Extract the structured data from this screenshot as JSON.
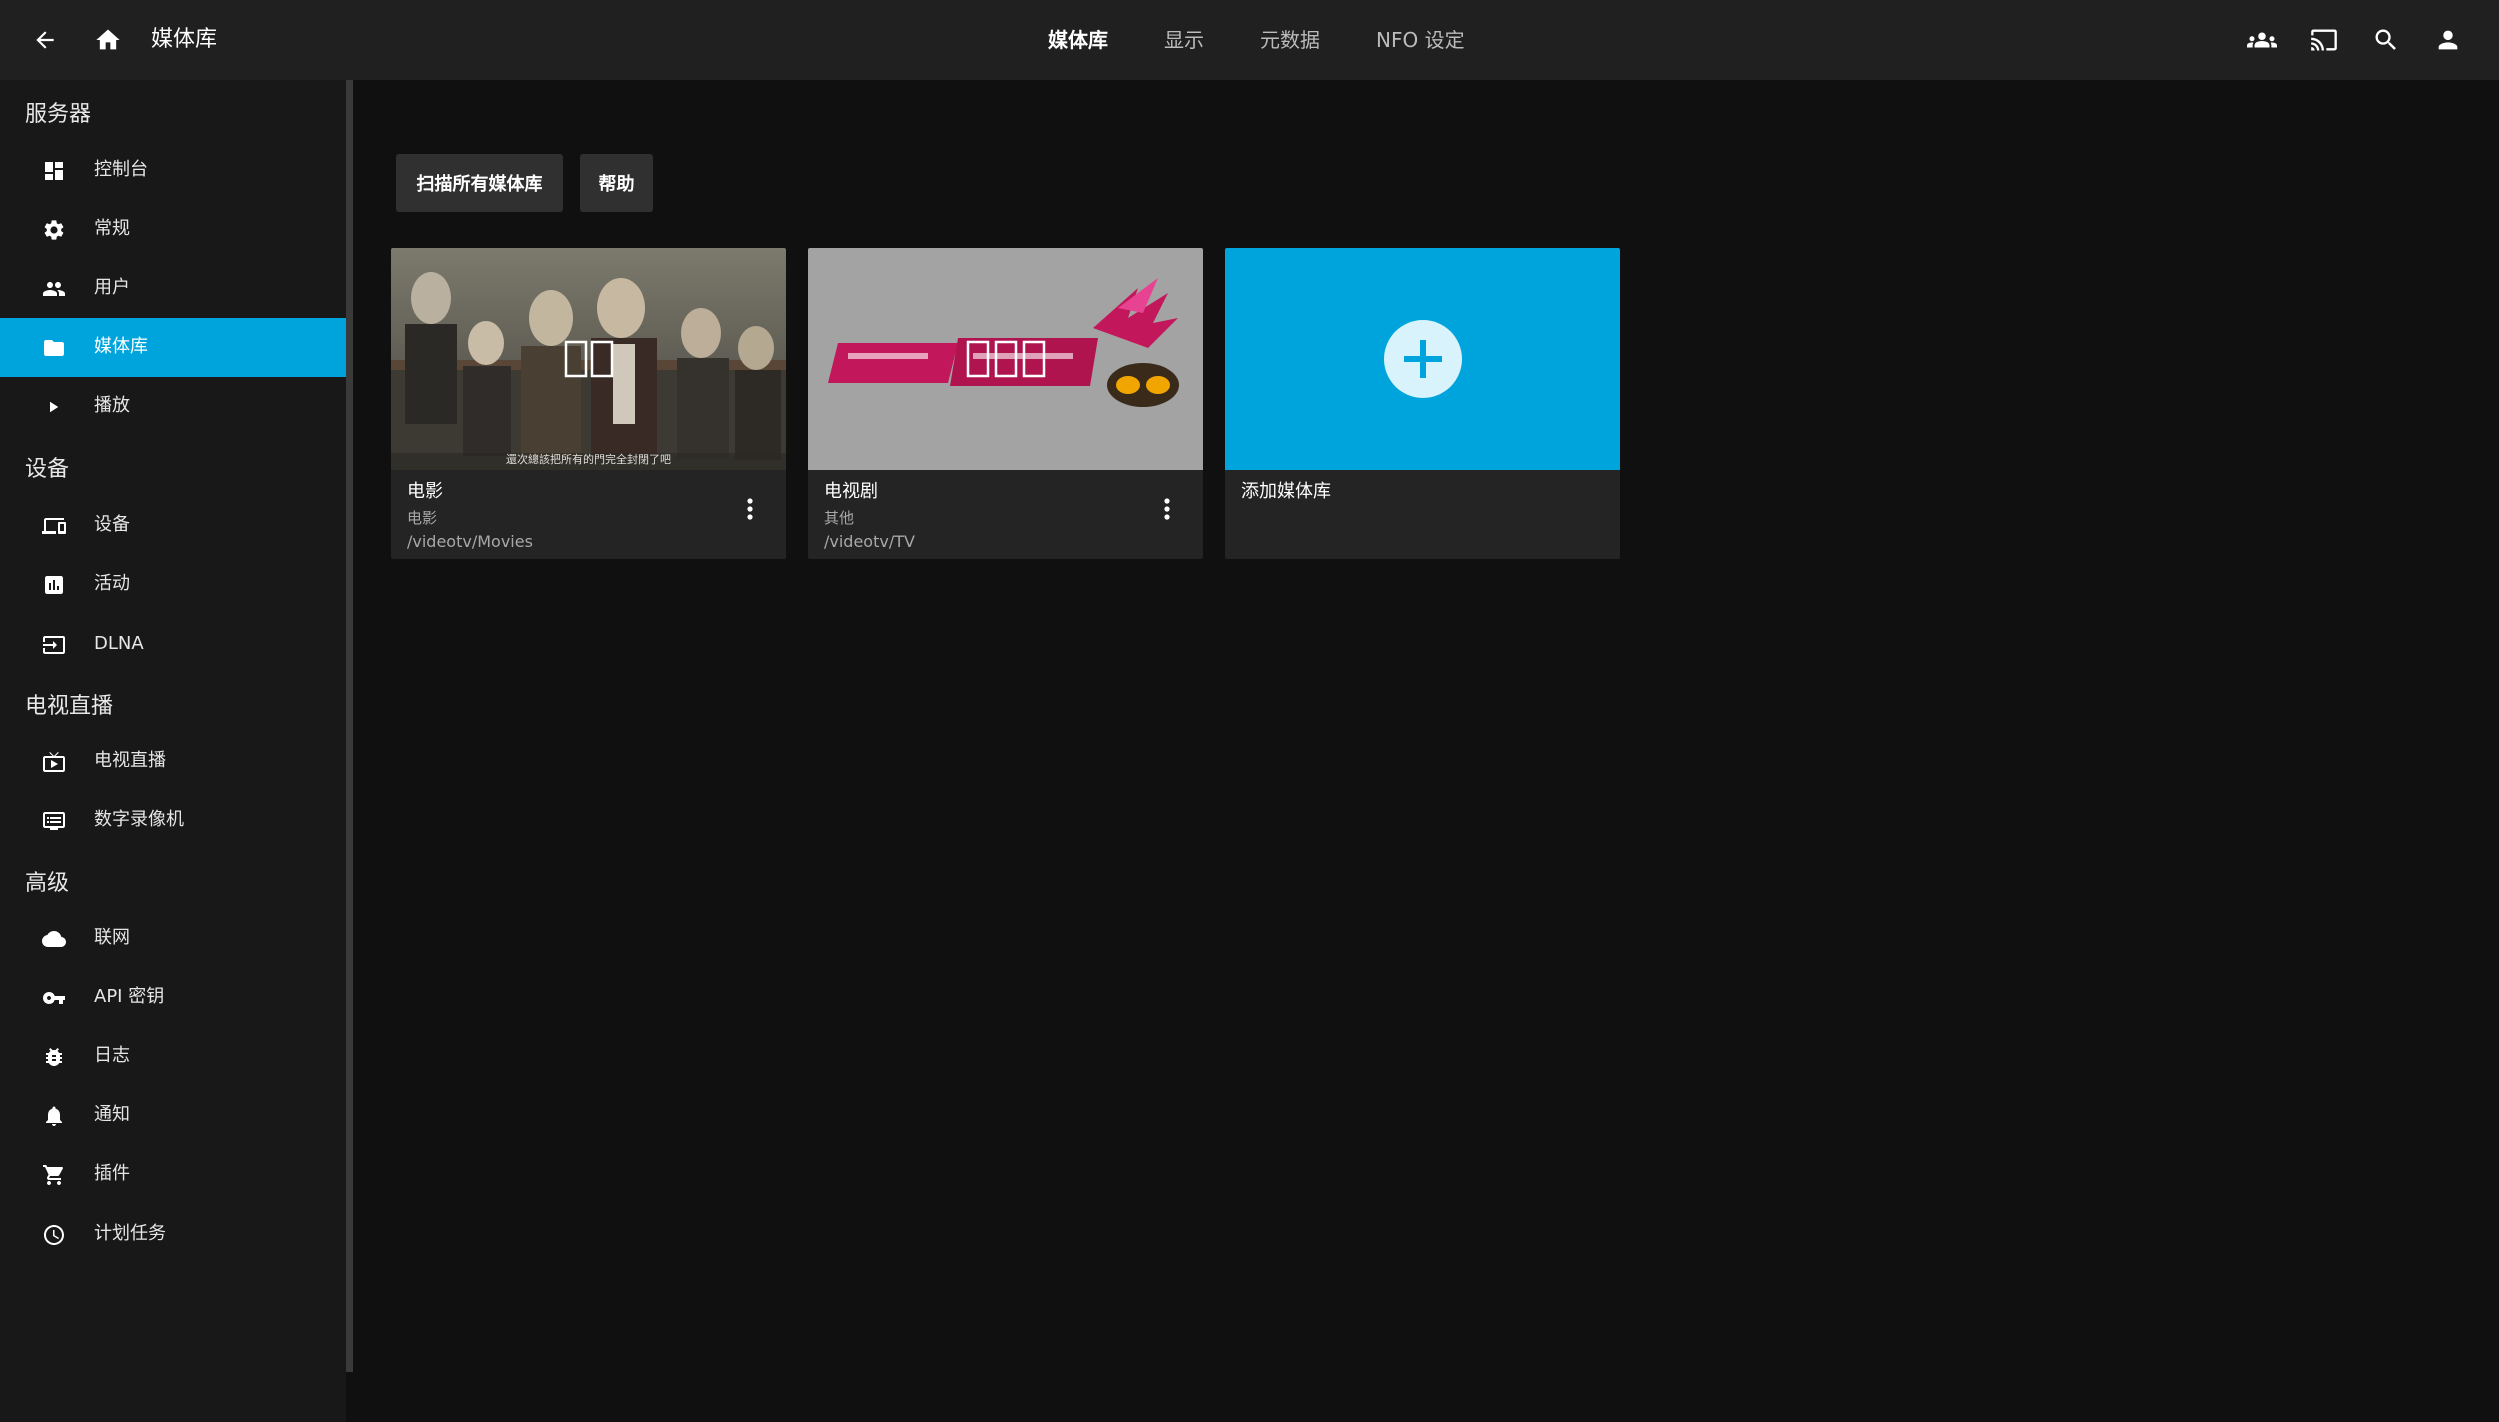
{
  "header": {
    "title": "媒体库",
    "tabs": [
      {
        "label": "媒体库",
        "active": true
      },
      {
        "label": "显示",
        "active": false
      },
      {
        "label": "元数据",
        "active": false
      },
      {
        "label": "NFO 设定",
        "active": false
      }
    ],
    "icons": [
      "back-arrow-icon",
      "home-icon",
      "users-icon",
      "cast-icon",
      "search-icon",
      "account-icon"
    ]
  },
  "sidebar": {
    "sections": [
      {
        "title": "服务器",
        "items": [
          {
            "label": "控制台",
            "icon": "dashboard-icon"
          },
          {
            "label": "常规",
            "icon": "gear-icon"
          },
          {
            "label": "用户",
            "icon": "people-icon"
          },
          {
            "label": "媒体库",
            "icon": "folder-icon",
            "active": true
          },
          {
            "label": "播放",
            "icon": "play-icon"
          }
        ]
      },
      {
        "title": "设备",
        "items": [
          {
            "label": "设备",
            "icon": "devices-icon"
          },
          {
            "label": "活动",
            "icon": "chart-icon"
          },
          {
            "label": "DLNA",
            "icon": "input-icon"
          }
        ]
      },
      {
        "title": "电视直播",
        "items": [
          {
            "label": "电视直播",
            "icon": "live-tv-icon"
          },
          {
            "label": "数字录像机",
            "icon": "dvr-icon"
          }
        ]
      },
      {
        "title": "高级",
        "items": [
          {
            "label": "联网",
            "icon": "cloud-icon"
          },
          {
            "label": "API 密钥",
            "icon": "key-icon"
          },
          {
            "label": "日志",
            "icon": "bug-icon"
          },
          {
            "label": "通知",
            "icon": "bell-icon"
          },
          {
            "label": "插件",
            "icon": "cart-icon"
          },
          {
            "label": "计划任务",
            "icon": "clock-icon"
          }
        ]
      }
    ]
  },
  "toolbar": {
    "scan_label": "扫描所有媒体库",
    "help_label": "帮助"
  },
  "libraries": [
    {
      "name": "电影",
      "type": "电影",
      "path": "/videotv/Movies",
      "caption": "還次總該把所有的門完全封閉了吧"
    },
    {
      "name": "电视剧",
      "type": "其他",
      "path": "/videotv/TV"
    }
  ],
  "add_library": {
    "label": "添加媒体库"
  },
  "colors": {
    "accent": "#00a4dc",
    "header": "#202020",
    "sidebar": "#181818",
    "background": "#101010",
    "card": "#242424"
  }
}
